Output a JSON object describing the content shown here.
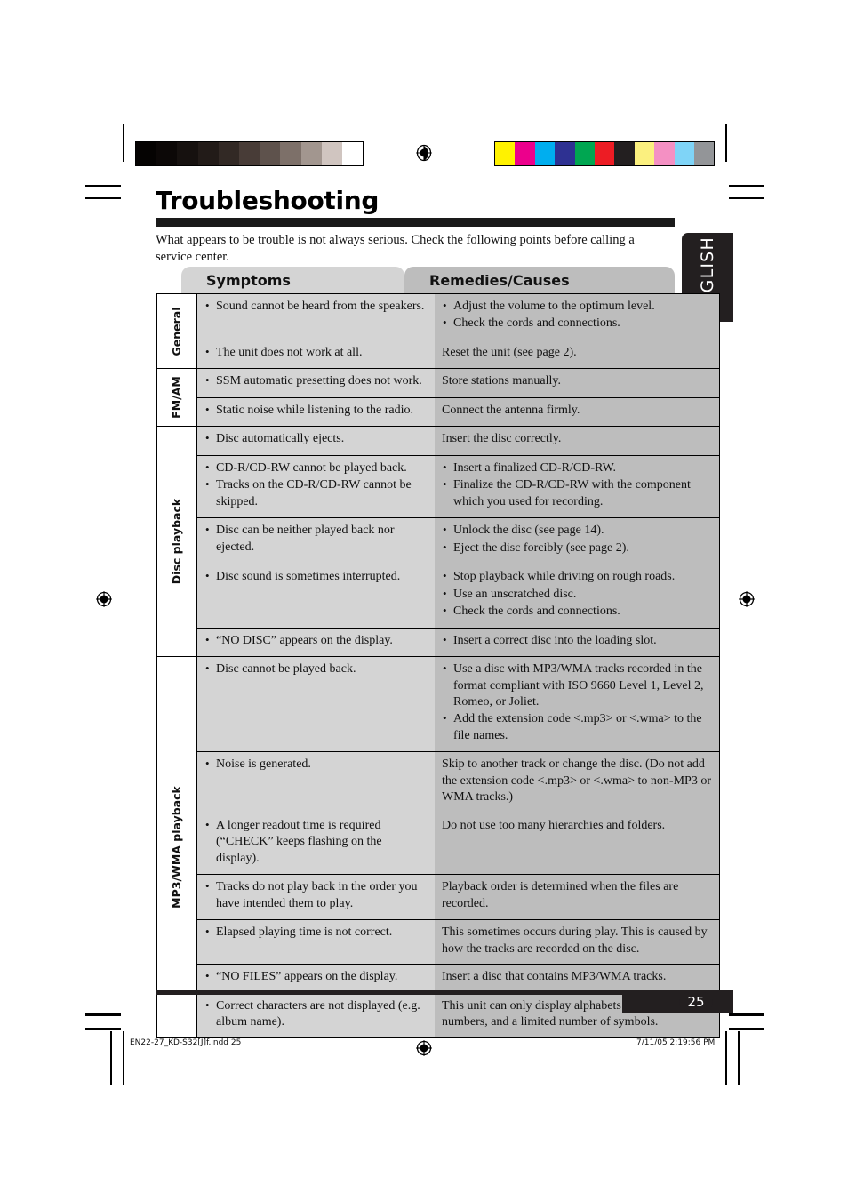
{
  "document": {
    "title": "Troubleshooting",
    "intro": "What appears to be trouble is not always serious. Check the following points before calling a service center.",
    "language_tab": "ENGLISH",
    "page_number": "25"
  },
  "table": {
    "headers": {
      "symptoms": "Symptoms",
      "remedies": "Remedies/Causes"
    },
    "sections": [
      {
        "label": "General",
        "rows": [
          {
            "symptoms": [
              "Sound cannot be heard from the speakers."
            ],
            "remedies": [
              "Adjust the volume to the optimum level.",
              "Check the cords and connections."
            ],
            "remedies_bulleted": true
          },
          {
            "symptoms": [
              "The unit does not work at all."
            ],
            "remedies": [
              "Reset the unit (see page 2)."
            ],
            "remedies_bulleted": false
          }
        ]
      },
      {
        "label": "FM/AM",
        "rows": [
          {
            "symptoms": [
              "SSM automatic presetting does not work."
            ],
            "remedies": [
              "Store stations manually."
            ],
            "remedies_bulleted": false
          },
          {
            "symptoms": [
              "Static noise while listening to the radio."
            ],
            "remedies": [
              "Connect the antenna firmly."
            ],
            "remedies_bulleted": false
          }
        ]
      },
      {
        "label": "Disc playback",
        "rows": [
          {
            "symptoms": [
              "Disc automatically ejects."
            ],
            "remedies": [
              "Insert the disc correctly."
            ],
            "remedies_bulleted": false
          },
          {
            "symptoms": [
              "CD-R/CD-RW cannot be played back.",
              "Tracks on the CD-R/CD-RW cannot be skipped."
            ],
            "remedies": [
              "Insert a finalized CD-R/CD-RW.",
              "Finalize the CD-R/CD-RW with the component which you used for recording."
            ],
            "remedies_bulleted": true
          },
          {
            "symptoms": [
              "Disc can be neither played back nor ejected."
            ],
            "remedies": [
              "Unlock the disc (see page 14).",
              "Eject the disc forcibly (see page 2)."
            ],
            "remedies_bulleted": true
          },
          {
            "symptoms": [
              "Disc sound is sometimes interrupted."
            ],
            "remedies": [
              "Stop playback while driving on rough roads.",
              "Use an unscratched disc.",
              "Check the cords and connections."
            ],
            "remedies_bulleted": true
          },
          {
            "symptoms": [
              "“NO DISC” appears on the display."
            ],
            "remedies": [
              "Insert a correct disc into the loading slot."
            ],
            "remedies_bulleted": true
          }
        ]
      },
      {
        "label": "MP3/WMA playback",
        "rows": [
          {
            "symptoms": [
              "Disc cannot be played back."
            ],
            "remedies": [
              "Use a disc with MP3/WMA tracks recorded in the format compliant with ISO 9660 Level 1, Level 2, Romeo, or Joliet.",
              "Add the extension code <.mp3> or <.wma> to the file names."
            ],
            "remedies_bulleted": true
          },
          {
            "symptoms": [
              "Noise is generated."
            ],
            "remedies": [
              "Skip to another track or change the disc. (Do not add the extension code <.mp3> or <.wma> to non-MP3 or WMA tracks.)"
            ],
            "remedies_bulleted": false
          },
          {
            "symptoms": [
              "A longer readout time is required (“CHECK” keeps flashing on the display)."
            ],
            "remedies": [
              "Do not use too many hierarchies and folders."
            ],
            "remedies_bulleted": false
          },
          {
            "symptoms": [
              "Tracks do not play back in the order you have intended them to play."
            ],
            "remedies": [
              "Playback order is determined when the files are recorded."
            ],
            "remedies_bulleted": false
          },
          {
            "symptoms": [
              "Elapsed playing time is not correct."
            ],
            "remedies": [
              "This sometimes occurs during play. This is caused by how the tracks are recorded on the disc."
            ],
            "remedies_bulleted": false
          },
          {
            "symptoms": [
              "“NO FILES” appears on the display."
            ],
            "remedies": [
              "Insert a disc that contains MP3/WMA tracks."
            ],
            "remedies_bulleted": false
          },
          {
            "symptoms": [
              "Correct characters are not displayed (e.g. album name)."
            ],
            "remedies": [
              "This unit can only display alphabets (capital: A – Z), numbers, and a limited number of symbols."
            ],
            "remedies_bulleted": false
          }
        ]
      }
    ]
  },
  "footer": {
    "file_name": "EN22-27_KD-S32[J]f.indd   25",
    "timestamp": "7/11/05   2:19:56 PM"
  },
  "print_marks": {
    "grayscale_ramp": [
      "#050302",
      "#0c0807",
      "#16110f",
      "#221b18",
      "#322925",
      "#483c37",
      "#5e524c",
      "#7d7069",
      "#a2968f",
      "#d0c5c0",
      "#ffffff"
    ],
    "color_bar": [
      "#fff200",
      "#ec008c",
      "#00aeef",
      "#2e3192",
      "#00a651",
      "#ed1c24",
      "#231f20",
      "#fbf07f",
      "#f490c3",
      "#7fd4f7",
      "#939598"
    ]
  }
}
